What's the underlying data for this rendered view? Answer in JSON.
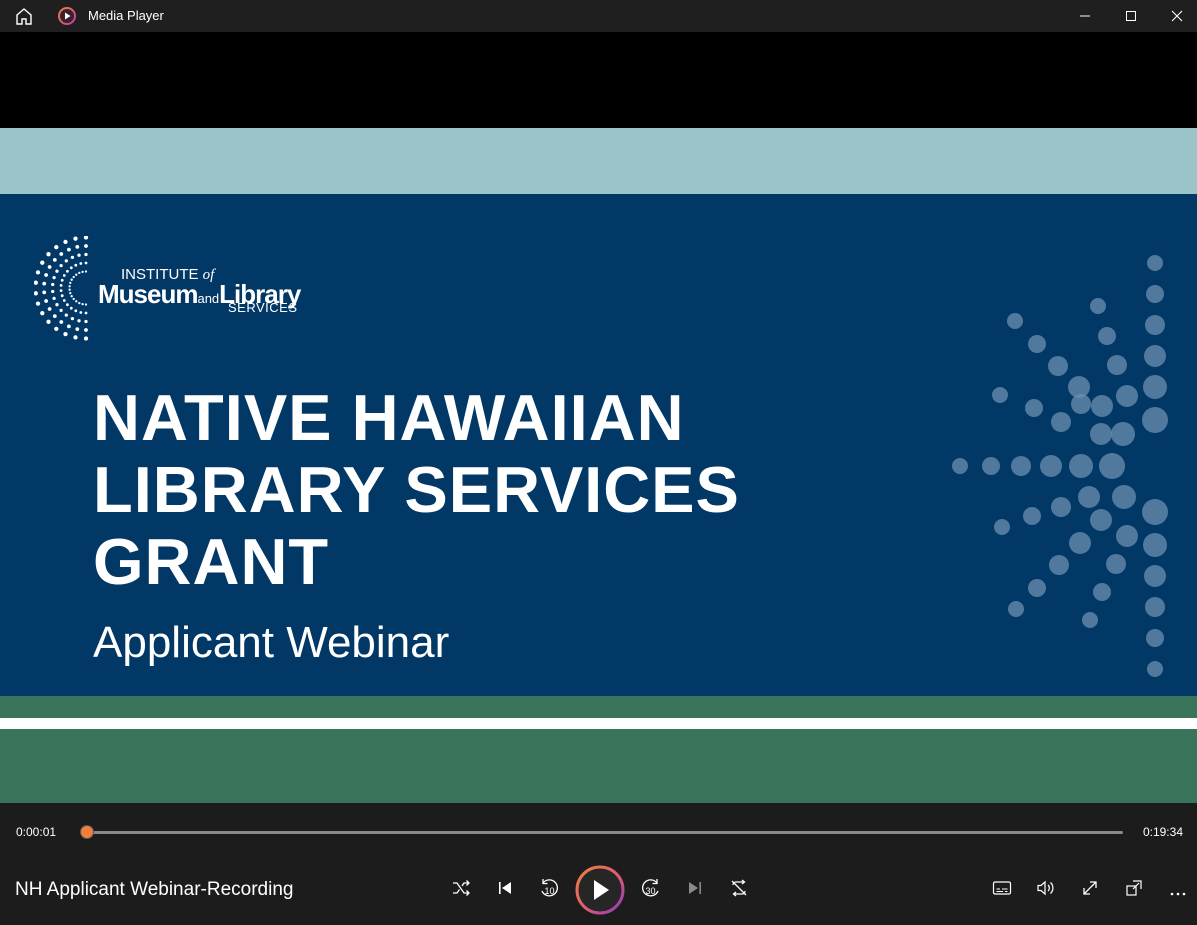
{
  "titlebar": {
    "app_title": "Media Player",
    "icons": [
      "home-icon",
      "app-icon",
      "minimize-icon",
      "maximize-icon",
      "close-icon"
    ]
  },
  "video": {
    "logo": {
      "line1": "INSTITUTE",
      "line1_of": "of",
      "line2a": "Museum",
      "line2_and": "and",
      "line2b": "Library",
      "line3": "SERVICES"
    },
    "headline": [
      "NATIVE HAWAIIAN",
      "LIBRARY SERVICES",
      "GRANT"
    ],
    "subtitle": "Applicant Webinar"
  },
  "playback": {
    "current_time": "0:00:01",
    "total_time": "0:19:34",
    "progress_fraction": 0.001
  },
  "controls": {
    "media_title": "NH Applicant Webinar-Recording",
    "skip_back_seconds": "10",
    "skip_forward_seconds": "30",
    "buttons": [
      "shuffle-icon",
      "previous-icon",
      "skip-back-10-icon",
      "play-icon",
      "skip-forward-30-icon",
      "next-icon",
      "repeat-icon",
      "subtitles-icon",
      "volume-icon",
      "fullscreen-icon",
      "mini-player-icon",
      "more-icon"
    ]
  },
  "colors": {
    "accent": "#f0803c",
    "slide_blue": "#023866",
    "slide_teal": "#9bc4c9",
    "slide_green": "#38735a"
  }
}
